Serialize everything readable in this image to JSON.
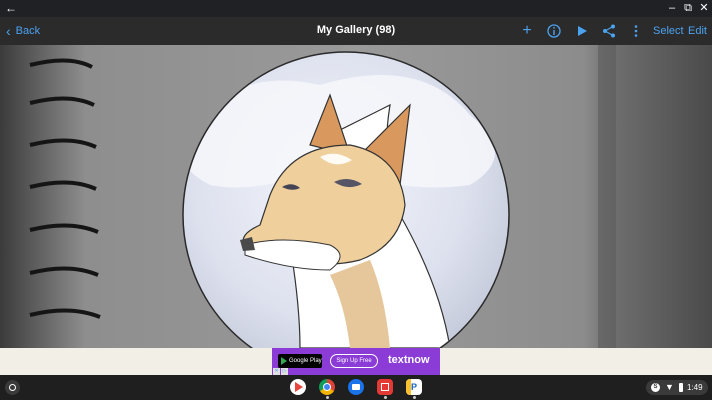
{
  "window": {
    "back_glyph": "←",
    "minimize_glyph": "–",
    "maximize_glyph": "⧉",
    "close_glyph": "✕"
  },
  "toolbar": {
    "back_label": "Back",
    "back_icon": "chevron-left-icon",
    "title": "My Gallery (98)",
    "icons": [
      "add-icon",
      "info-icon",
      "play-icon",
      "share-icon",
      "more-icon"
    ],
    "select_label": "Select",
    "edit_label": "Edit",
    "accent_color": "#4ba3f0"
  },
  "ad": {
    "store_badge": "Google Play",
    "cta": "Sign Up Free",
    "brand": "textnow",
    "background_color": "#8b3bd6"
  },
  "shelf": {
    "apps": [
      "play-store-icon",
      "chrome-icon",
      "files-icon",
      "gallery-icon",
      "ip-app-icon"
    ],
    "account_initial": "S",
    "time": "1:49"
  }
}
